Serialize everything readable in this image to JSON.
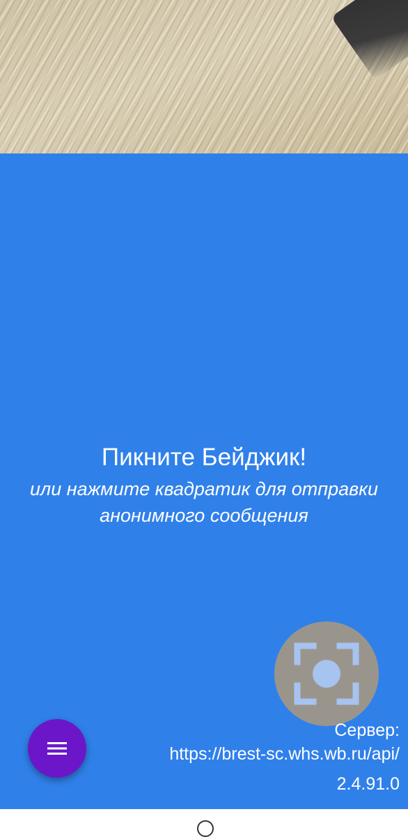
{
  "main": {
    "title": "Пикните Бейджик!",
    "subtitle": "или нажмите квадратик для отправки анонимного сообщения"
  },
  "server": {
    "label": "Сервер:",
    "url": "https://brest-sc.whs.wb.ru/api/",
    "version": "2.4.91.0"
  },
  "buttons": {
    "scan_icon": "focus-scan-icon",
    "menu_icon": "hamburger-menu-icon"
  },
  "colors": {
    "panel": "#3080ea",
    "menu_button": "#6b17c9",
    "scan_button": "#a09687",
    "scan_icon": "#a7c3ef"
  }
}
